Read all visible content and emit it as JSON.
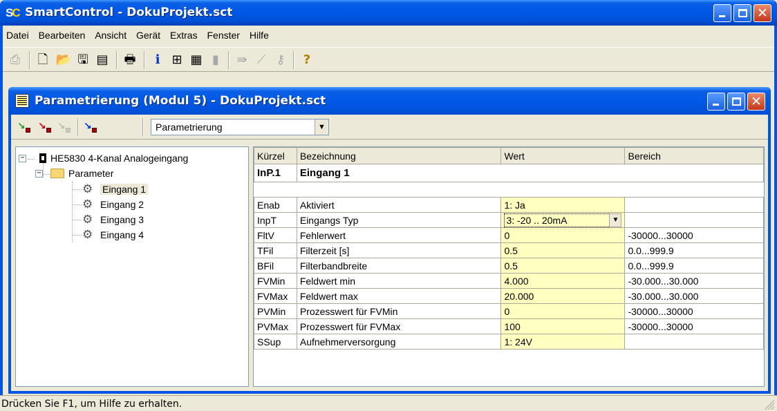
{
  "window": {
    "title": "SmartControl - DokuProjekt.sct",
    "icon_letters": [
      "S",
      "C"
    ]
  },
  "menu": [
    "Datei",
    "Bearbeiten",
    "Ansicht",
    "Gerät",
    "Extras",
    "Fenster",
    "Hilfe"
  ],
  "toolbar": {
    "icons": [
      "print-preview-icon",
      "new-file-icon",
      "open-folder-icon",
      "save-icon",
      "export-icon",
      "print-icon",
      "info-icon",
      "device-icon",
      "parameter-list-icon",
      "bar-icon",
      "transfer-icon",
      "chart-icon",
      "key-icon",
      "help-icon"
    ]
  },
  "child_window": {
    "title": "Parametrierung (Modul 5) - DokuProjekt.sct",
    "toolbar_icons": [
      "read-params-icon",
      "write-params-icon",
      "compare-params-icon",
      "param-info-icon"
    ],
    "view_select": {
      "value": "Parametrierung"
    }
  },
  "tree": {
    "module": "HE5830 4-Kanal Analogeingang",
    "folder": "Parameter",
    "items": [
      "Eingang 1",
      "Eingang 2",
      "Eingang 3",
      "Eingang 4"
    ],
    "selected": "Eingang 1"
  },
  "grid": {
    "headers": [
      "Kürzel",
      "Bezeichnung",
      "Wert",
      "Bereich"
    ],
    "group": {
      "code": "InP.1",
      "name": "Eingang 1"
    },
    "rows": [
      {
        "code": "Enab",
        "name": "Aktiviert",
        "value": "1: Ja",
        "range": ""
      },
      {
        "code": "InpT",
        "name": "Eingangs Typ",
        "value": "3: -20 .. 20mA",
        "range": ""
      },
      {
        "code": "FltV",
        "name": "Fehlerwert",
        "value": "0",
        "range": "-30000...30000"
      },
      {
        "code": "TFil",
        "name": "Filterzeit [s]",
        "value": "0.5",
        "range": "0.0...999.9"
      },
      {
        "code": "BFil",
        "name": "Filterbandbreite",
        "value": "0.5",
        "range": "0.0...999.9"
      },
      {
        "code": "FVMin",
        "name": "Feldwert min",
        "value": "4.000",
        "range": "-30.000...30.000"
      },
      {
        "code": "FVMax",
        "name": "Feldwert max",
        "value": "20.000",
        "range": "-30.000...30.000"
      },
      {
        "code": "PVMin",
        "name": "Prozesswert für FVMin",
        "value": "0",
        "range": "-30000...30000"
      },
      {
        "code": "PVMax",
        "name": "Prozesswert für FVMax",
        "value": "100",
        "range": "-30000...30000"
      },
      {
        "code": "SSup",
        "name": "Aufnehmerversorgung",
        "value": "1: 24V",
        "range": ""
      }
    ]
  },
  "status": {
    "text": "Drücken Sie F1, um Hilfe zu erhalten."
  },
  "colors": {
    "titlebar": "#0058e6",
    "value_cell": "#ffffbf",
    "close_button": "#c4361a"
  }
}
